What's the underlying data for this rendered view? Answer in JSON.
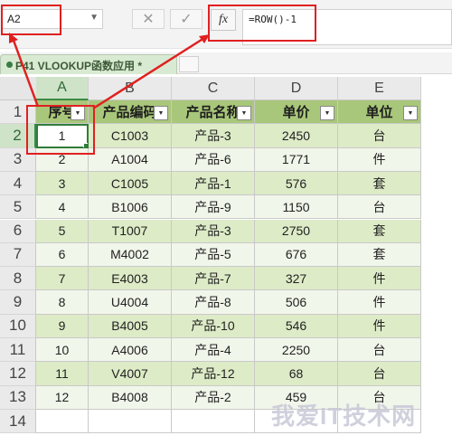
{
  "name_box": {
    "value": "A2"
  },
  "formula_bar": {
    "fx_label": "fx",
    "formula": "=ROW()-1"
  },
  "sheet_tab": {
    "label": "P41 VLOOKUP函数应用 *"
  },
  "columns": [
    "A",
    "B",
    "C",
    "D",
    "E"
  ],
  "rows": [
    "1",
    "2",
    "3",
    "4",
    "5",
    "6",
    "7",
    "8",
    "9",
    "10",
    "11",
    "12",
    "13",
    "14"
  ],
  "headers": [
    "序号",
    "产品编码",
    "产品名称",
    "单价",
    "单位"
  ],
  "table": [
    [
      "1",
      "C1003",
      "产品-3",
      "2450",
      "台"
    ],
    [
      "2",
      "A1004",
      "产品-6",
      "1771",
      "件"
    ],
    [
      "3",
      "C1005",
      "产品-1",
      "576",
      "套"
    ],
    [
      "4",
      "B1006",
      "产品-9",
      "1150",
      "台"
    ],
    [
      "5",
      "T1007",
      "产品-3",
      "2750",
      "套"
    ],
    [
      "6",
      "M4002",
      "产品-5",
      "676",
      "套"
    ],
    [
      "7",
      "E4003",
      "产品-7",
      "327",
      "件"
    ],
    [
      "8",
      "U4004",
      "产品-8",
      "506",
      "件"
    ],
    [
      "9",
      "B4005",
      "产品-10",
      "546",
      "件"
    ],
    [
      "10",
      "A4006",
      "产品-4",
      "2250",
      "台"
    ],
    [
      "11",
      "V4007",
      "产品-12",
      "68",
      "台"
    ],
    [
      "12",
      "B4008",
      "产品-2",
      "459",
      "台"
    ]
  ],
  "watermark": "我爱IT技术网",
  "colors": {
    "header_fill": "#a9c77a",
    "band_dark": "#ddebc7",
    "band_light": "#f1f6ea",
    "highlight": "#e02020",
    "active": "#2f7d3a"
  }
}
